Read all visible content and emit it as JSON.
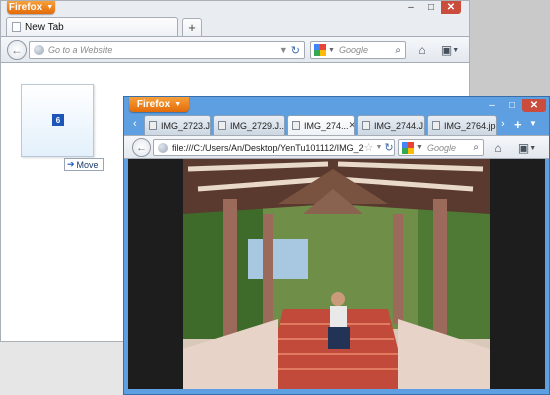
{
  "back_window": {
    "menu_label": "Firefox",
    "tab_title": "New Tab",
    "new_tab": "+",
    "url_placeholder": "Go to a Website",
    "search_placeholder": "Google",
    "controls": {
      "minimize": "–",
      "maximize": "□",
      "close": "✕"
    },
    "thumbnail_badge": "6",
    "drag_tooltip": "Move"
  },
  "front_window": {
    "menu_label": "Firefox",
    "tabs": [
      {
        "label": "IMG_2723.J..."
      },
      {
        "label": "IMG_2729.J..."
      },
      {
        "label": "IMG_274..."
      },
      {
        "label": "IMG_2744.J..."
      },
      {
        "label": "IMG_2764.jp..."
      }
    ],
    "active_tab_close": "✕",
    "url": "file:///C:/Users/An/Desktop/YenTu101112/IMG_2",
    "search_placeholder": "Google",
    "controls": {
      "minimize": "–",
      "maximize": "□",
      "close": "✕"
    }
  },
  "colors": {
    "firefox_orange": "#e8750f",
    "front_frame": "#5d9fe0",
    "close_red": "#c94c3c"
  }
}
